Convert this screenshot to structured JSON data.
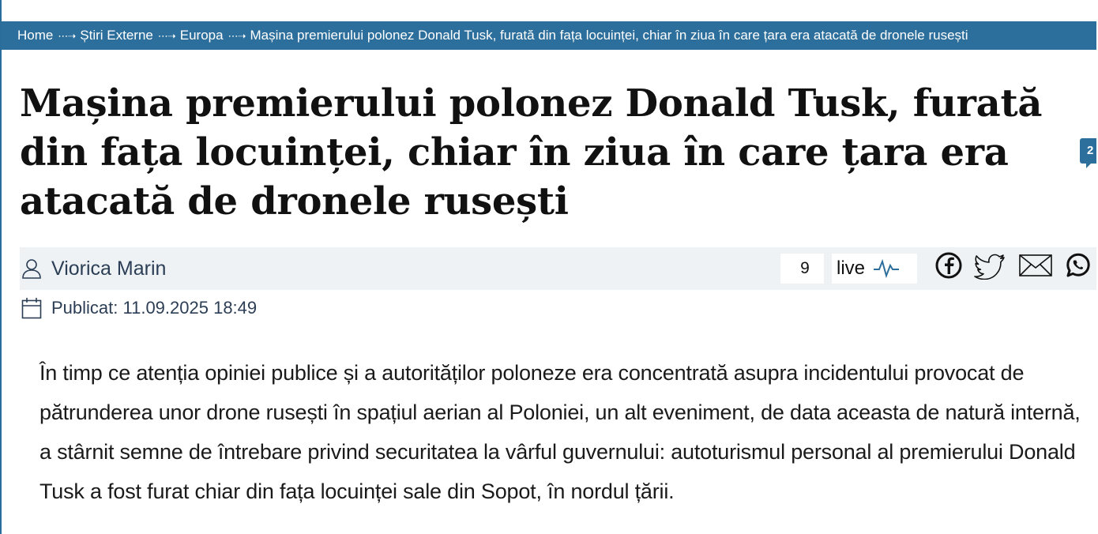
{
  "breadcrumb": {
    "items": [
      "Home",
      "Știri Externe",
      "Europa"
    ],
    "current": "Mașina premierului polonez Donald Tusk, furată din fața locuinței, chiar în ziua în care țara era atacată de dronele rusești",
    "separator": "⋯➝"
  },
  "article": {
    "title": "Mașina premierului polonez Donald Tusk, furată din fața locuinței, chiar în ziua în care țara era atacată de dronele rusești",
    "comment_count": "2",
    "author": "Viorica Marin",
    "live_count": "9",
    "live_label": "live",
    "published": "Publicat: 11.09.2025 18:49",
    "lead": "În timp ce atenția opiniei publice și a autorităților poloneze era concentrată asupra incidentului provocat de pătrunderea unor drone rusești în spațiul aerian al Poloniei, un alt eveniment, de data aceasta de natură internă, a stârnit semne de întrebare privind securitatea la vârful guvernului: autoturismul personal al premierului Donald Tusk a fost furat chiar din fața locuinței sale din Sopot, în nordul țării."
  },
  "share": {
    "icons": [
      "facebook-icon",
      "twitter-icon",
      "email-icon",
      "whatsapp-icon"
    ]
  },
  "colors": {
    "accent": "#2d6f9c",
    "meta_bg": "#eef2f5"
  }
}
